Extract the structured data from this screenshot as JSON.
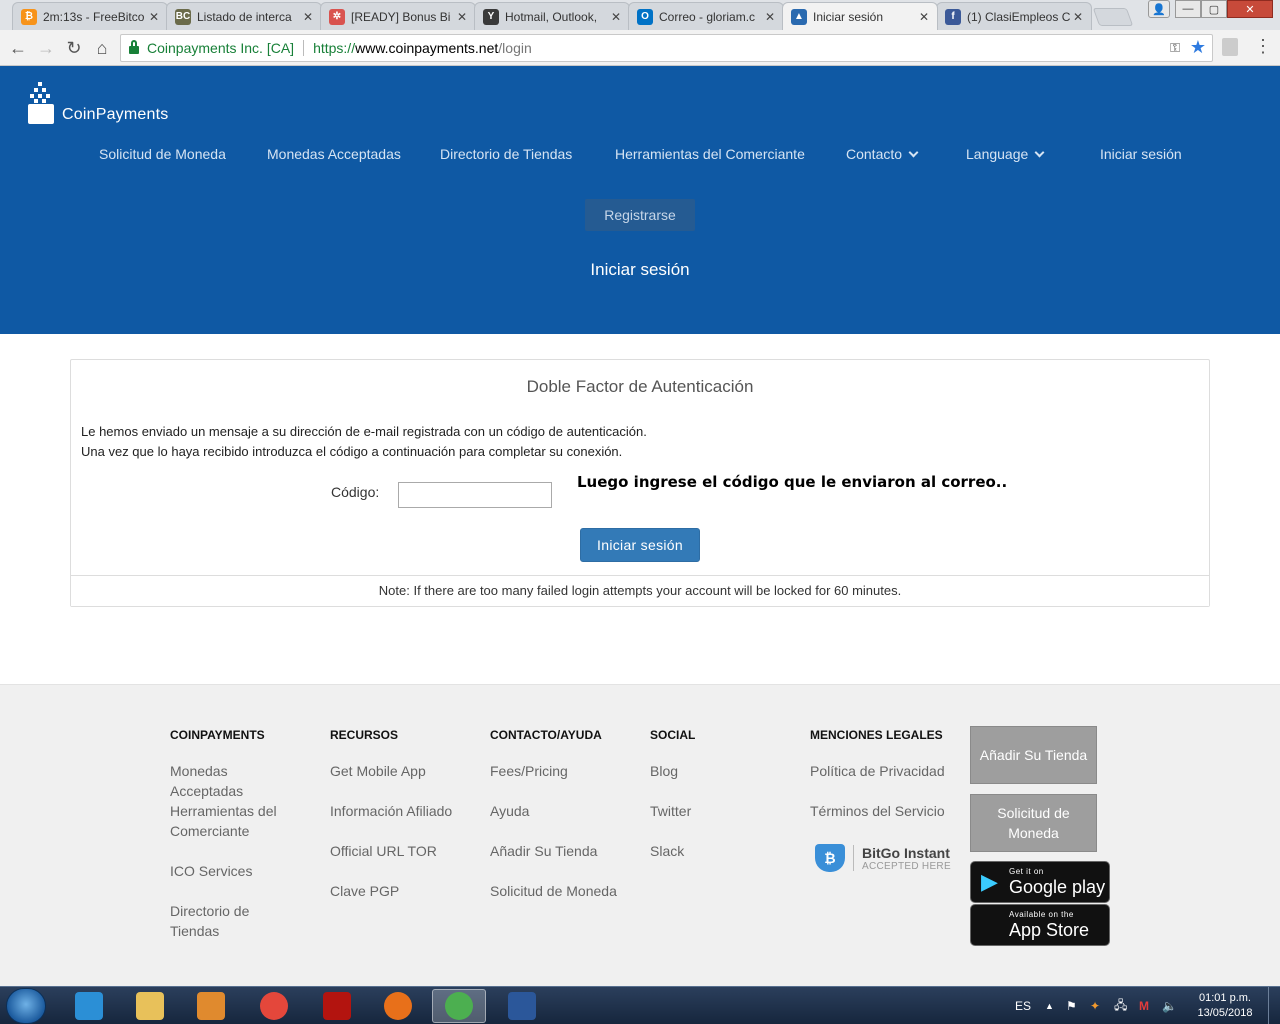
{
  "browser": {
    "tabs": [
      {
        "title": "2m:13s - FreeBitco",
        "icon": "bitcoin-icon",
        "color": "#f7931a"
      },
      {
        "title": "Listado de interca",
        "icon": "bc-icon",
        "color": "#6b6b4a"
      },
      {
        "title": "[READY] Bonus Bi",
        "icon": "pattern-icon",
        "color": "#d9534f"
      },
      {
        "title": "Hotmail, Outlook,",
        "icon": "y-icon",
        "color": "#3a3a3a"
      },
      {
        "title": "Correo - gloriam.c",
        "icon": "outlook-icon",
        "color": "#0072c6"
      },
      {
        "title": "Iniciar sesión",
        "icon": "coinpayments-icon",
        "color": "#2a6ab0"
      },
      {
        "title": "(1) ClasiEmpleos C",
        "icon": "facebook-icon",
        "color": "#3b5998"
      }
    ],
    "active_tab": 5,
    "omnibox": {
      "security_label": "Coinpayments Inc. [CA]",
      "url_proto": "https://",
      "url_host": "www.coinpayments.net",
      "url_path": "/login"
    }
  },
  "header": {
    "logo_text": "CoinPayments",
    "nav": [
      {
        "label": "Solicitud de Moneda",
        "dropdown": false
      },
      {
        "label": "Monedas Acceptadas",
        "dropdown": false
      },
      {
        "label": "Directorio de Tiendas",
        "dropdown": false
      },
      {
        "label": "Herramientas del Comerciante",
        "dropdown": false
      },
      {
        "label": "Contacto",
        "dropdown": true
      },
      {
        "label": " Language",
        "dropdown": true
      },
      {
        "label": "Iniciar sesión",
        "dropdown": false
      }
    ],
    "register_label": "Registrarse",
    "page_title": "Iniciar sesión",
    "bg_color": "#0f59a4"
  },
  "panel": {
    "title": "Doble Factor de Autenticación",
    "message_line1": "Le hemos enviado un mensaje a su dirección de e-mail registrada con un código de autenticación.",
    "message_line2": "Una vez que lo haya recibido introduzca el código a continuación para completar su conexión.",
    "code_label": "Código:",
    "code_value": "",
    "annotation": "Luego ingrese el código que le enviaron al correo..",
    "login_button": "Iniciar sesión",
    "note": "Note: If there are too many failed login attempts your account will be locked for 60 minutes.",
    "button_color": "#337ab7"
  },
  "footer": {
    "columns": [
      {
        "heading": "COINPAYMENTS",
        "links": [
          "Monedas Acceptadas",
          "Herramientas del Comerciante",
          "ICO Services",
          "Directorio de Tiendas"
        ]
      },
      {
        "heading": "RECURSOS",
        "links": [
          "Get Mobile App",
          "Información Afiliado",
          "Official URL TOR",
          "Clave PGP"
        ]
      },
      {
        "heading": "CONTACTO/AYUDA",
        "links": [
          "Fees/Pricing",
          "Ayuda",
          "Añadir Su Tienda",
          "Solicitud de Moneda"
        ]
      },
      {
        "heading": "SOCIAL",
        "links": [
          "Blog",
          "Twitter",
          "Slack"
        ]
      },
      {
        "heading": "MENCIONES LEGALES",
        "links": [
          "Política de Privacidad",
          "Términos del Servicio"
        ]
      }
    ],
    "buttons": [
      "Añadir Su Tienda",
      "Solicitud de Moneda"
    ],
    "bitgo": {
      "title": "BitGo Instant",
      "subtitle": "ACCEPTED HERE"
    },
    "google_play": {
      "small": "Get it on",
      "big": "Google play"
    },
    "app_store": {
      "small": "Available on the",
      "big": "App Store"
    }
  },
  "taskbar": {
    "apps": [
      {
        "name": "internet-explorer-icon",
        "color": "#2b8fd6"
      },
      {
        "name": "file-explorer-icon",
        "color": "#e8c15a"
      },
      {
        "name": "media-player-icon",
        "color": "#e08a2e"
      },
      {
        "name": "camera-app-icon",
        "color": "#e4473b"
      },
      {
        "name": "acrobat-icon",
        "color": "#b3140f"
      },
      {
        "name": "firefox-icon",
        "color": "#e8701a"
      },
      {
        "name": "chrome-icon",
        "color": "#4caf50"
      },
      {
        "name": "word-icon",
        "color": "#2b579a"
      }
    ],
    "active_app": 6,
    "language": "ES",
    "time": "01:01 p.m.",
    "date": "13/05/2018"
  }
}
